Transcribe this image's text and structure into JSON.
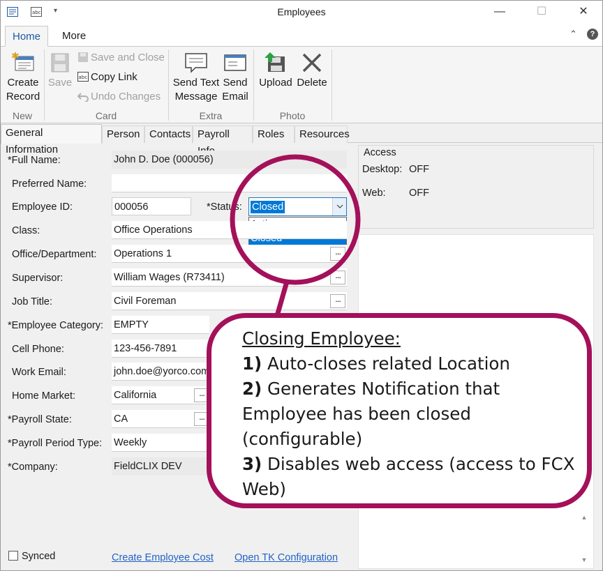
{
  "window": {
    "title": "Employees"
  },
  "ribbon": {
    "tabs": [
      {
        "label": "Home"
      },
      {
        "label": "More"
      }
    ],
    "groups": {
      "new": {
        "label": "New",
        "create_record": "Create\nRecord"
      },
      "card": {
        "label": "Card",
        "save": "Save",
        "save_and_close": "Save and Close",
        "copy_link": "Copy Link",
        "undo_changes": "Undo Changes"
      },
      "extra": {
        "label": "Extra",
        "send_text": "Send Text\nMessage",
        "send_email": "Send\nEmail"
      },
      "photo": {
        "label": "Photo",
        "upload": "Upload",
        "delete": "Delete"
      }
    }
  },
  "page_tabs": [
    {
      "label": "General Information"
    },
    {
      "label": "Person"
    },
    {
      "label": "Contacts"
    },
    {
      "label": "Payroll Info"
    },
    {
      "label": "Roles"
    },
    {
      "label": "Resources"
    }
  ],
  "form": {
    "full_name": {
      "label": "*Full Name:",
      "value": "John D. Doe (000056)"
    },
    "preferred_name": {
      "label": "Preferred Name:",
      "value": ""
    },
    "employee_id": {
      "label": "Employee ID:",
      "value": "000056"
    },
    "status": {
      "label": "*Status:",
      "value": "Closed",
      "options": [
        "Active",
        "Closed"
      ]
    },
    "class": {
      "label": "Class:",
      "value": "Office Operations"
    },
    "office_department": {
      "label": "Office/Department:",
      "value": "Operations 1"
    },
    "supervisor": {
      "label": "Supervisor:",
      "value": "William Wages (R73411)"
    },
    "job_title": {
      "label": "Job Title:",
      "value": "Civil Foreman"
    },
    "employee_category": {
      "label": "*Employee Category:",
      "value": "EMPTY"
    },
    "cell_phone": {
      "label": "Cell Phone:",
      "value": "123-456-7891"
    },
    "work_email": {
      "label": "Work Email:",
      "value": "john.doe@yorco.com"
    },
    "home_market": {
      "label": "Home Market:",
      "value": "California"
    },
    "payroll_state": {
      "label": "*Payroll State:",
      "value": "CA"
    },
    "payroll_period_type": {
      "label": "*Payroll Period Type:",
      "value": "Weekly"
    },
    "company": {
      "label": "*Company:",
      "value": "FieldCLIX DEV"
    }
  },
  "access": {
    "title": "Access",
    "desktop_label": "Desktop:",
    "desktop_value": "OFF",
    "web_label": "Web:",
    "web_value": "OFF"
  },
  "footer": {
    "synced_label": "Synced",
    "create_employee_cost": "Create Employee Cost",
    "open_tk_configuration": "Open TK Configuration"
  },
  "callout": {
    "heading": "Closing Employee:",
    "item1_num": "1)",
    "item1_text": " Auto-closes related Location",
    "item2_num": "2)",
    "item2_text": " Generates Notification that",
    "item2_line2": "Employee has been closed",
    "item2_line3": "(configurable)",
    "item3_num": "3)",
    "item3_text": " Disables web access (access to FCX",
    "item3_line2": "Web)"
  },
  "colors": {
    "accent": "#0078d7",
    "callout_border": "#a4105a",
    "link": "#1f63c6"
  }
}
